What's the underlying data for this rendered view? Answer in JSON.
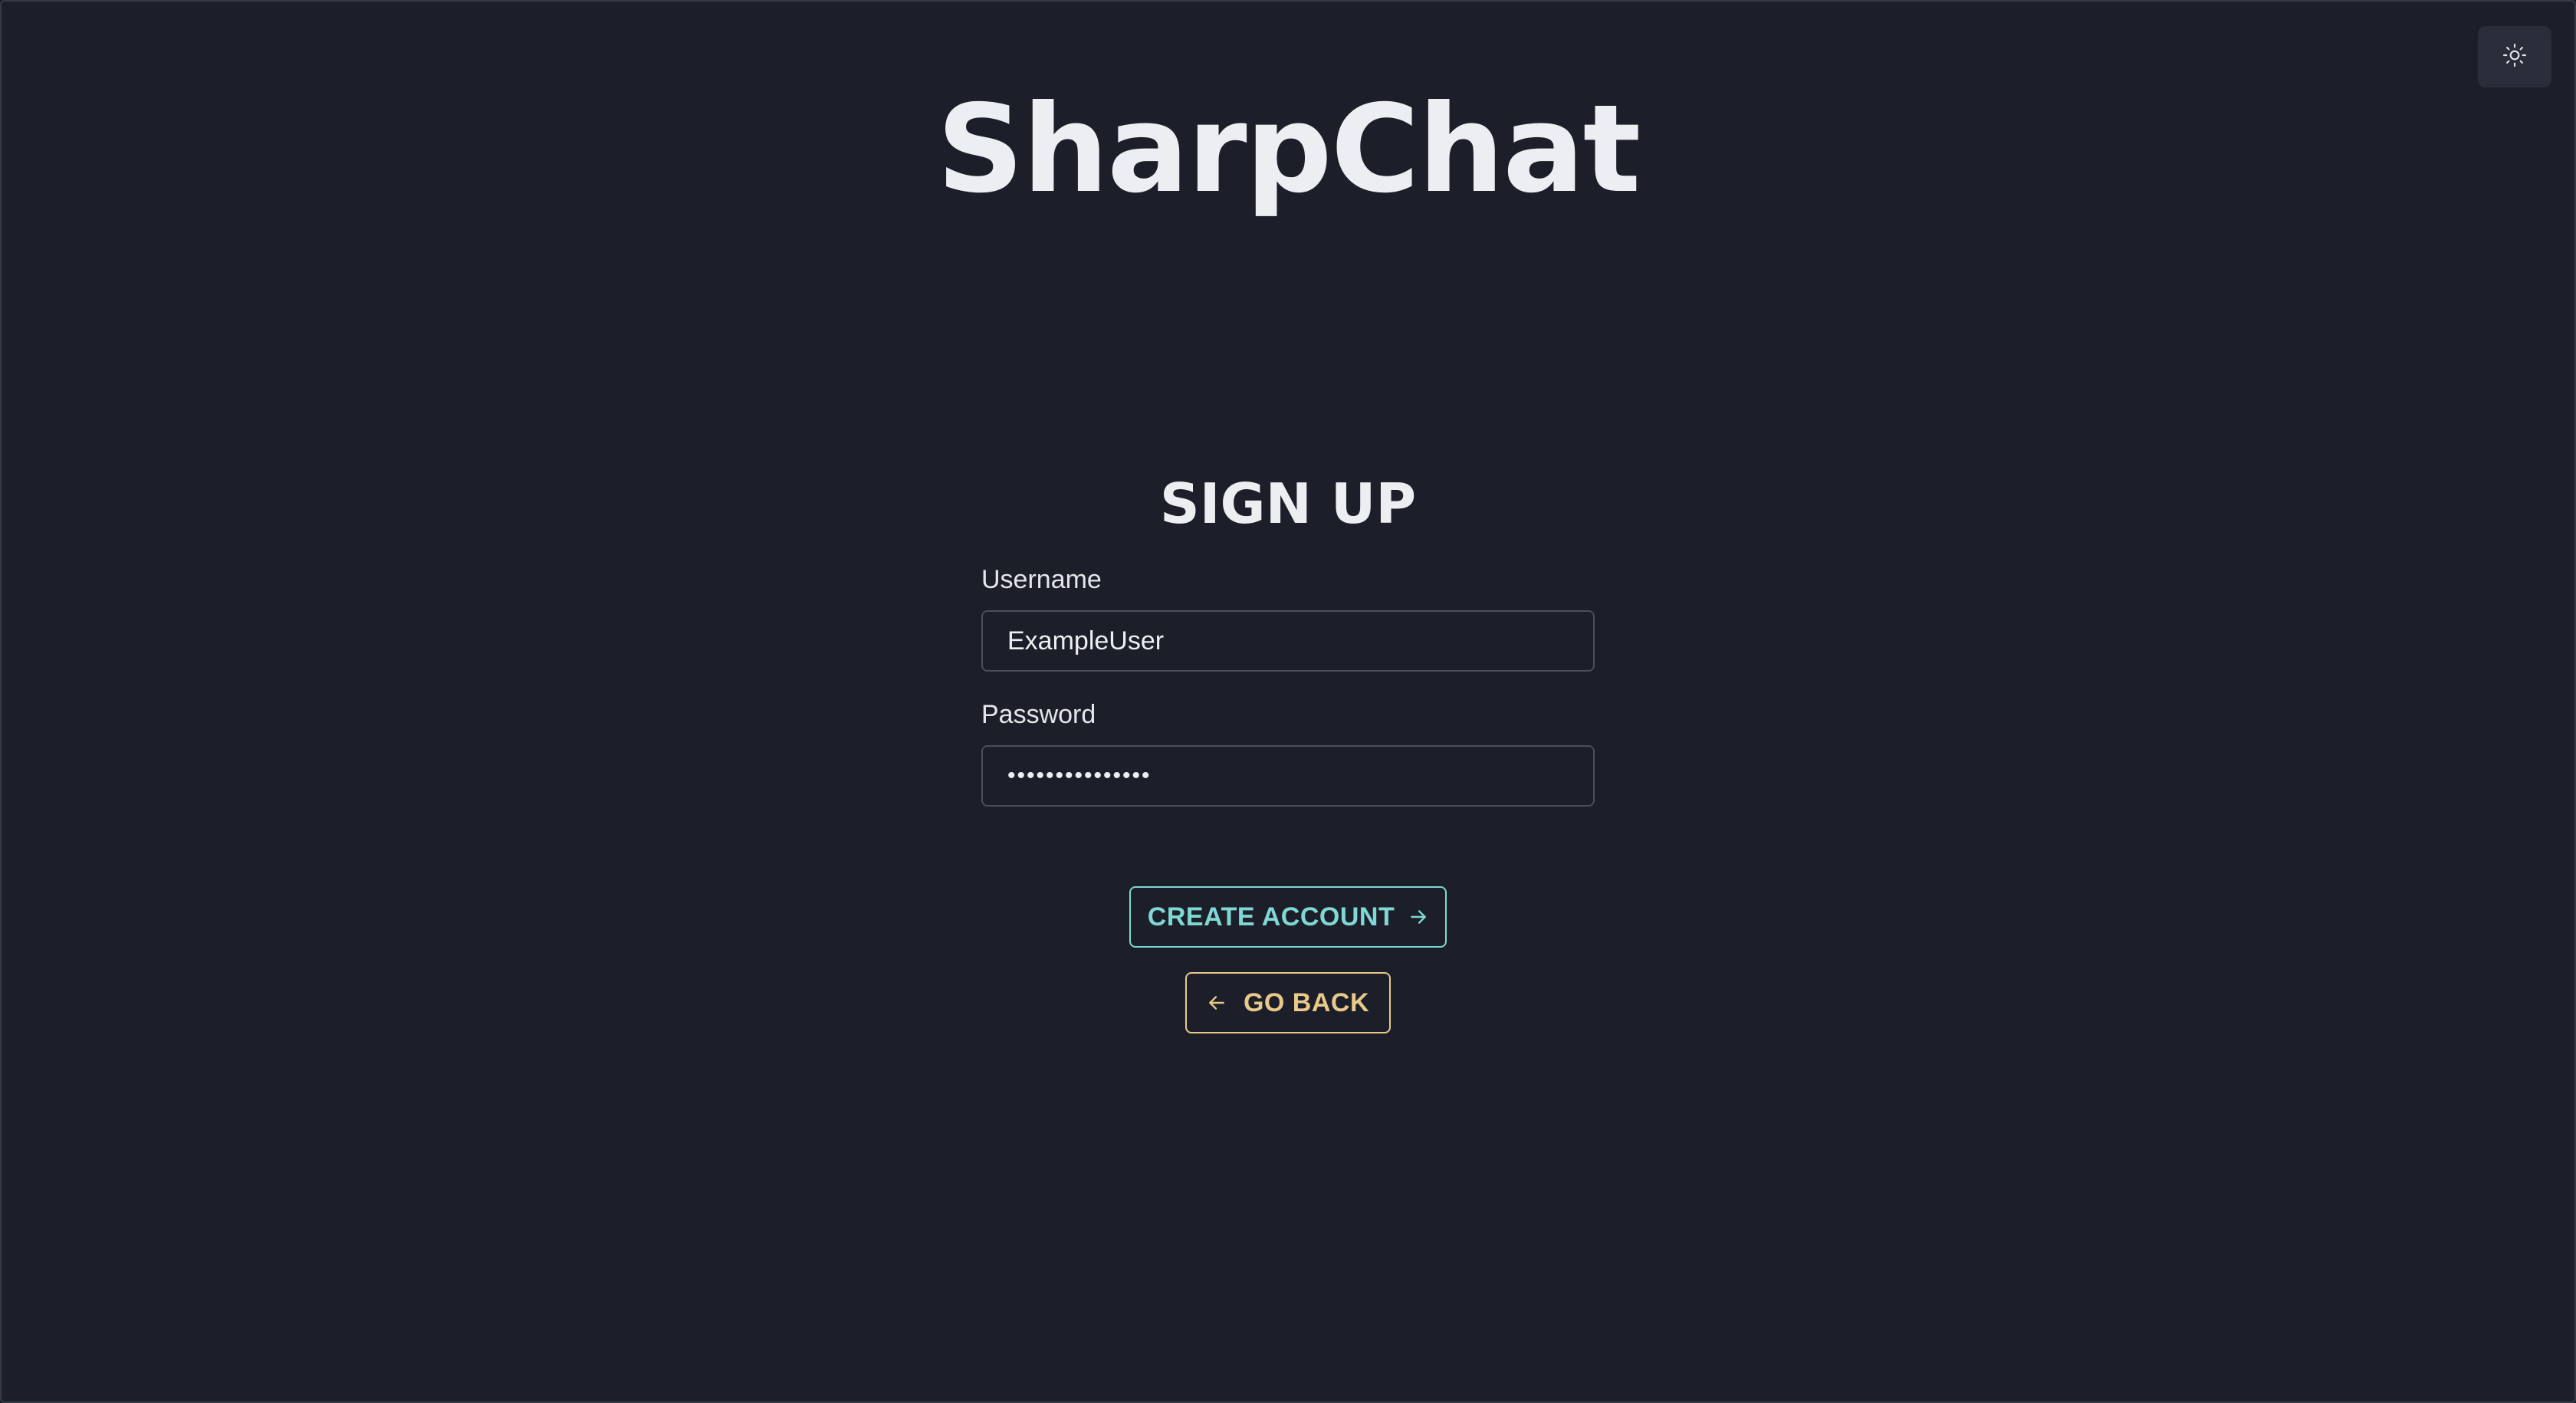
{
  "app": {
    "title": "SharpChat"
  },
  "header": {
    "theme_toggle_icon": "sun-icon"
  },
  "form": {
    "heading": "SIGN UP",
    "username": {
      "label": "Username",
      "value": "ExampleUser"
    },
    "password": {
      "label": "Password",
      "value": "•••••••••••••••"
    },
    "create_account_label": "CREATE ACCOUNT",
    "create_account_icon": "arrow-right-icon",
    "go_back_label": "GO BACK",
    "go_back_icon": "arrow-left-icon"
  },
  "colors": {
    "background": "#1c1f29",
    "primary_accent": "#7fd8d3",
    "secondary_accent": "#e9c98a",
    "text": "#eceef2"
  }
}
